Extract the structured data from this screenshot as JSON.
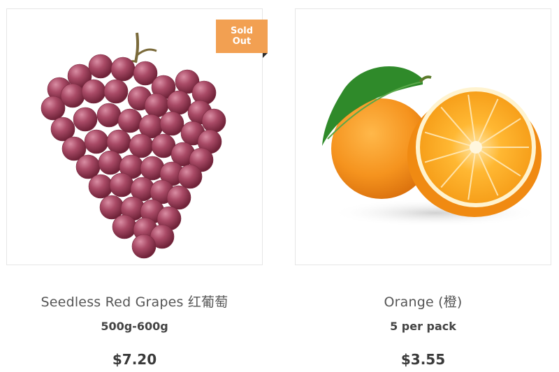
{
  "products": [
    {
      "name": "Seedless Red Grapes 红葡萄",
      "description": "500g-600g",
      "price": "$7.20",
      "badge_line1": "Sold",
      "badge_line2": "Out",
      "image": "red-grapes",
      "sold_out": true
    },
    {
      "name": "Orange (橙)",
      "description": "5 per pack",
      "price": "$3.55",
      "image": "oranges",
      "sold_out": false
    }
  ],
  "colors": {
    "badge": "#f2a052",
    "badge_fold": "#2b2b2b",
    "grape": "#9b3d55",
    "orange": "#f5931e",
    "leaf": "#2f8a2a",
    "border": "#e6e6e6"
  }
}
